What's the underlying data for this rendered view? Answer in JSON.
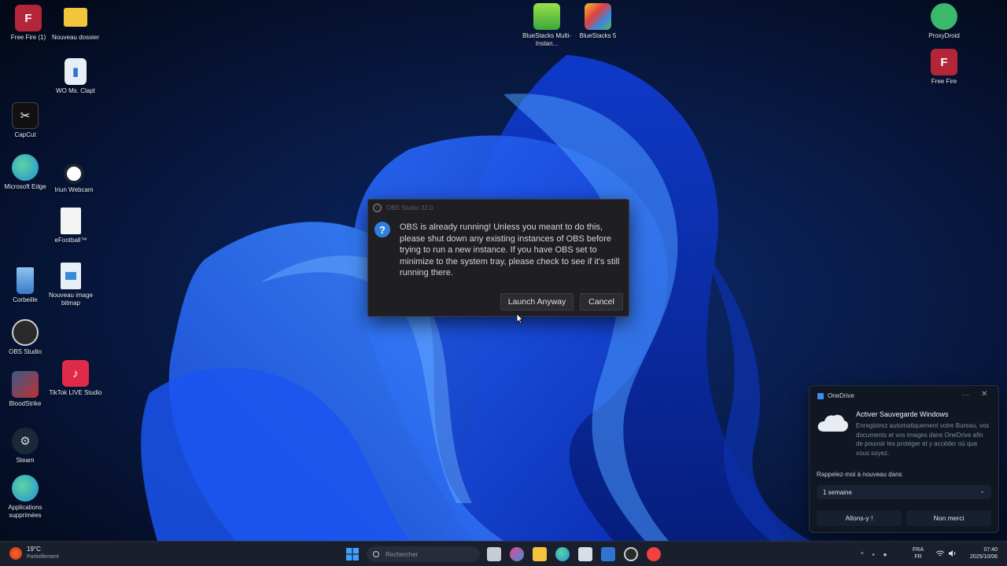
{
  "desktop": {
    "icons": [
      {
        "label": "Free Fire (1)",
        "icon": "free-fire-icon",
        "color": "#b3263a"
      },
      {
        "label": "Nouveau dossier",
        "icon": "folder-icon",
        "color": "#f3c53d"
      },
      {
        "label": "WO Ms. Clapt",
        "icon": "document-icon",
        "color": "#2f74d0"
      },
      {
        "label": "CapCut",
        "icon": "capcut-icon",
        "color": "#111111"
      },
      {
        "label": "Microsoft Edge",
        "icon": "edge-icon",
        "color": "#1f8fd8"
      },
      {
        "label": "Iriun Webcam",
        "icon": "webcam-icon",
        "color": "#e8e8e8"
      },
      {
        "label": "eFootball™",
        "icon": "file-icon",
        "color": "#f4f4f4"
      },
      {
        "label": "Corbeille",
        "icon": "recycle-bin-icon",
        "color": "#5aa0e0"
      },
      {
        "label": "Nouveau image bitmap",
        "icon": "bitmap-icon",
        "color": "#e8eef6"
      },
      {
        "label": "OBS Studio",
        "icon": "obs-icon",
        "color": "#2a2a2a"
      },
      {
        "label": "BloodStrike",
        "icon": "bloodstrike-icon",
        "color": "#3a5a8a"
      },
      {
        "label": "TikTok LIVE Studio",
        "icon": "tiktok-live-icon",
        "color": "#e02a4a"
      },
      {
        "label": "Steam",
        "icon": "steam-icon",
        "color": "#1b2838"
      },
      {
        "label": "Applications supprimées",
        "icon": "edge-icon",
        "color": "#1f8fd8"
      },
      {
        "label": "BlueStacks Multi-Instan...",
        "icon": "bluestacks-multi-icon",
        "color": "#6ac93a"
      },
      {
        "label": "BlueStacks 5",
        "icon": "bluestacks-icon",
        "color": "#5ab84a"
      },
      {
        "label": "ProxyDroid",
        "icon": "proxydroid-icon",
        "color": "#3bb86a"
      },
      {
        "label": "Free Fire",
        "icon": "free-fire-icon",
        "color": "#b3263a"
      }
    ]
  },
  "dialog": {
    "title": "OBS Studio 32.0",
    "message": "OBS is already running! Unless you meant to do this, please shut down any existing instances of OBS before trying to run a new instance. If you have OBS set to minimize to the system tray, please check to see if it's still running there.",
    "launch_label": "Launch Anyway",
    "cancel_label": "Cancel",
    "question_glyph": "?"
  },
  "notification": {
    "app": "OneDrive",
    "more_glyph": "···",
    "close_glyph": "✕",
    "title": "Activer Sauvegarde Windows",
    "body": "Enregistrez automatiquement votre Bureau, vos documents et vos images dans OneDrive afin de pouvoir les protéger et y accéder où que vous soyez.",
    "remind_label": "Rappelez-moi à nouveau dans",
    "remind_value": "1 semaine",
    "chevron_glyph": "⌄",
    "accept_label": "Allons-y !",
    "decline_label": "Non merci"
  },
  "taskbar": {
    "weather_temp": "19°C",
    "weather_cond": "Partiellement",
    "search_placeholder": "Rechercher",
    "tray_chevron": "^",
    "lang_top": "FRA",
    "lang_bottom": "FR",
    "time": "07:40",
    "date": "2025/10/06"
  },
  "colors": {
    "accent": "#2f7fe0",
    "dialog_bg": "#1f1f23",
    "toast_bg": "#101722",
    "taskbar_bg": "#1a1f2b"
  }
}
